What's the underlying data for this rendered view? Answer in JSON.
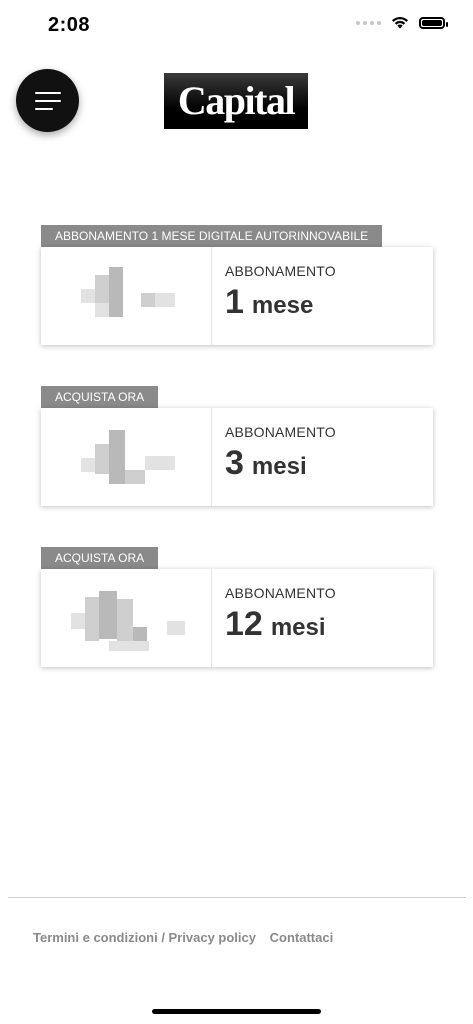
{
  "status_bar": {
    "time": "2:08",
    "icons": [
      "signal-icon",
      "wifi-icon",
      "battery-icon"
    ]
  },
  "header": {
    "menu_icon": "hamburger-menu-icon",
    "logo_text": "Capital"
  },
  "offers": [
    {
      "tag": "ABBONAMENTO 1 MESE DIGITALE AUTORINNOVABILE",
      "kind": "ABBONAMENTO",
      "number": "1",
      "unit": "mese"
    },
    {
      "tag": "ACQUISTA ORA",
      "kind": "ABBONAMENTO",
      "number": "3",
      "unit": "mesi"
    },
    {
      "tag": "ACQUISTA ORA",
      "kind": "ABBONAMENTO",
      "number": "12",
      "unit": "mesi"
    }
  ],
  "footer": {
    "terms_privacy": "Termini e condizioni / Privacy policy",
    "contact": "Contattaci"
  },
  "colors": {
    "tag_bg": "#8a8a8a",
    "text": "#333333",
    "menu_bg": "#111111"
  }
}
